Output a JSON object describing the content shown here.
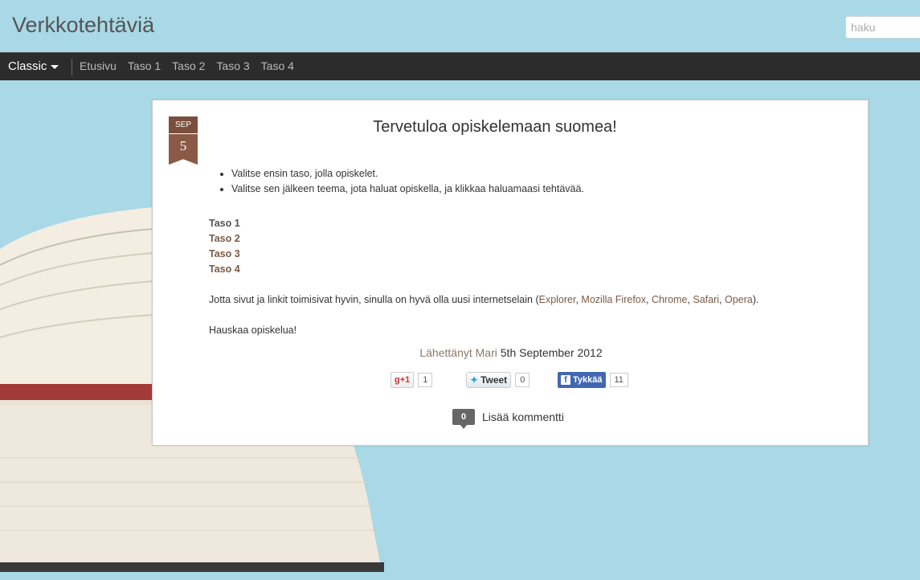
{
  "site": {
    "title": "Verkkotehtäviä"
  },
  "search": {
    "placeholder": "haku"
  },
  "nav": {
    "view_label": "Classic",
    "links": [
      "Etusivu",
      "Taso 1",
      "Taso 2",
      "Taso 3",
      "Taso 4"
    ]
  },
  "post": {
    "date_month": "SEP",
    "date_day": "5",
    "title": "Tervetuloa opiskelemaan suomea!",
    "bullets": [
      "Valitse ensin taso, jolla opiskelet.",
      "Valitse sen jälkeen teema, jota haluat opiskella, ja klikkaa haluamaasi tehtävää."
    ],
    "levels": [
      "Taso 1",
      "Taso 2",
      "Taso 3",
      "Taso 4"
    ],
    "browser_text": "Jotta sivut ja linkit toimisivat hyvin, sinulla on hyvä olla uusi internetselain (",
    "browsers": [
      "Explorer",
      "Mozilla Firefox",
      "Chrome",
      "Safari",
      "Opera"
    ],
    "browser_text_end": ").",
    "closing": "Hauskaa opiskelua!",
    "posted_by_label": "Lähettänyt",
    "author": "Mari",
    "posted_date": "5th September 2012"
  },
  "social": {
    "gplus_label": "+1",
    "gplus_count": "1",
    "tweet_label": "Tweet",
    "tweet_count": "0",
    "fb_label": "Tykkää",
    "fb_count": "11"
  },
  "comments": {
    "count": "0",
    "label": "Lisää kommentti"
  },
  "colors": {
    "navbar": "#2c2c2c",
    "accent": "#7a5a45",
    "background": "#a9d8e6"
  }
}
